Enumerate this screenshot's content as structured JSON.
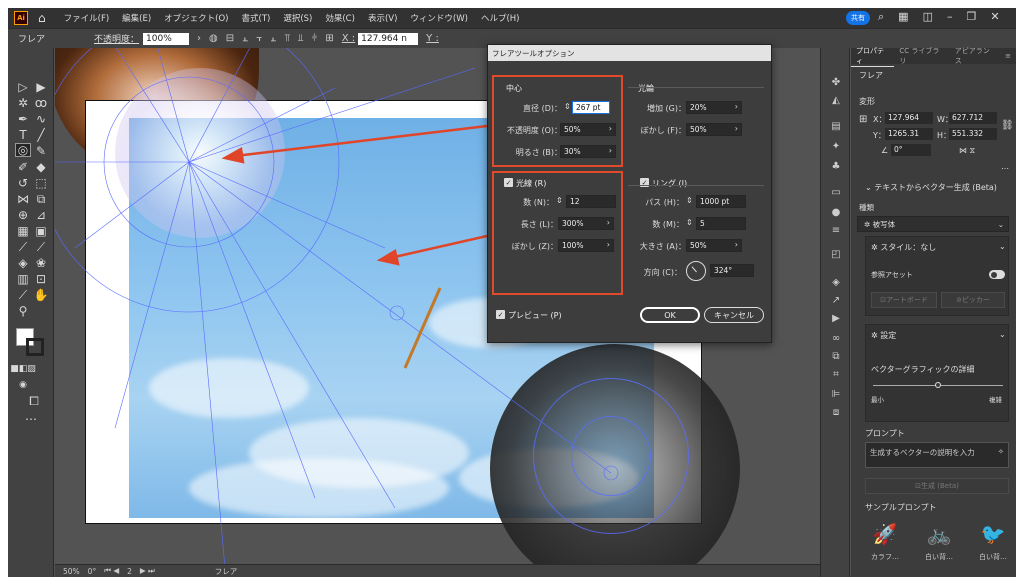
{
  "menubar": {
    "logo": "Ai",
    "items": [
      "ファイル(F)",
      "編集(E)",
      "オブジェクト(O)",
      "書式(T)",
      "選択(S)",
      "効果(C)",
      "表示(V)",
      "ウィンドウ(W)",
      "ヘルプ(H)"
    ],
    "share": "共有"
  },
  "controlbar": {
    "selection": "フレア",
    "opacity_label": "不透明度：",
    "opacity_value": "100%",
    "x_label": "X :",
    "x_value": "127.964 n",
    "y_label": "Y :"
  },
  "dialog": {
    "title": "フレアツールオプション",
    "center": {
      "title": "中心",
      "diameter_label": "直径 (D)：",
      "diameter_value": "267 pt",
      "opacity_label": "不透明度 (O)：",
      "opacity_value": "50%",
      "brightness_label": "明るさ (B)：",
      "brightness_value": "30%"
    },
    "halo": {
      "title": "光輪",
      "growth_label": "増加 (G)：",
      "growth_value": "20%",
      "fuzziness_label": "ぼかし (F)：",
      "fuzziness_value": "50%"
    },
    "rays": {
      "title": "光線 (R)",
      "number_label": "数 (N)：",
      "number_value": "12",
      "longest_label": "長さ (L)：",
      "longest_value": "300%",
      "fuzziness_label": "ぼかし (Z)：",
      "fuzziness_value": "100%"
    },
    "rings": {
      "title": "リング (I)",
      "path_label": "パス (H)：",
      "path_value": "1000 pt",
      "number_label": "数 (M)：",
      "number_value": "5",
      "largest_label": "大きさ (A)：",
      "largest_value": "50%",
      "direction_label": "方向 (C)：",
      "direction_value": "324°"
    },
    "preview": "プレビュー (P)",
    "ok": "OK",
    "cancel": "キャンセル"
  },
  "panel": {
    "tabs": [
      "プロパティ",
      "CC ライブラリ",
      "アピアランス"
    ],
    "object_name": "フレア",
    "transform_title": "変形",
    "x_label": "X：",
    "x_value": "127.964",
    "y_label": "Y：",
    "y_value": "1265.31",
    "w_label": "W：",
    "w_value": "627.712",
    "h_label": "H：",
    "h_value": "551.332",
    "angle_value": "0°",
    "text_to_vector": "テキストからベクター生成 (Beta)",
    "type_label": "種類",
    "type_value": "被写体",
    "style_value": "スタイル：なし",
    "reference_asset": "参照アセット",
    "artboard_btn": "アートボード",
    "picker_btn": "ピッカー",
    "settings": "設定",
    "detail_label": "ベクターグラフィックの詳細",
    "detail_min": "最小",
    "detail_max": "複雑",
    "prompt_title": "プロンプト",
    "prompt_placeholder": "生成するベクターの説明を入力",
    "generate_btn": "生成 (Beta)",
    "sample_title": "サンプルプロンプト",
    "samples": [
      "カラフ…",
      "白い背…",
      "白い背…"
    ]
  },
  "statusbar": {
    "zoom": "50%",
    "rotation": "0°",
    "artboard_num": "2",
    "tool": "フレア"
  }
}
